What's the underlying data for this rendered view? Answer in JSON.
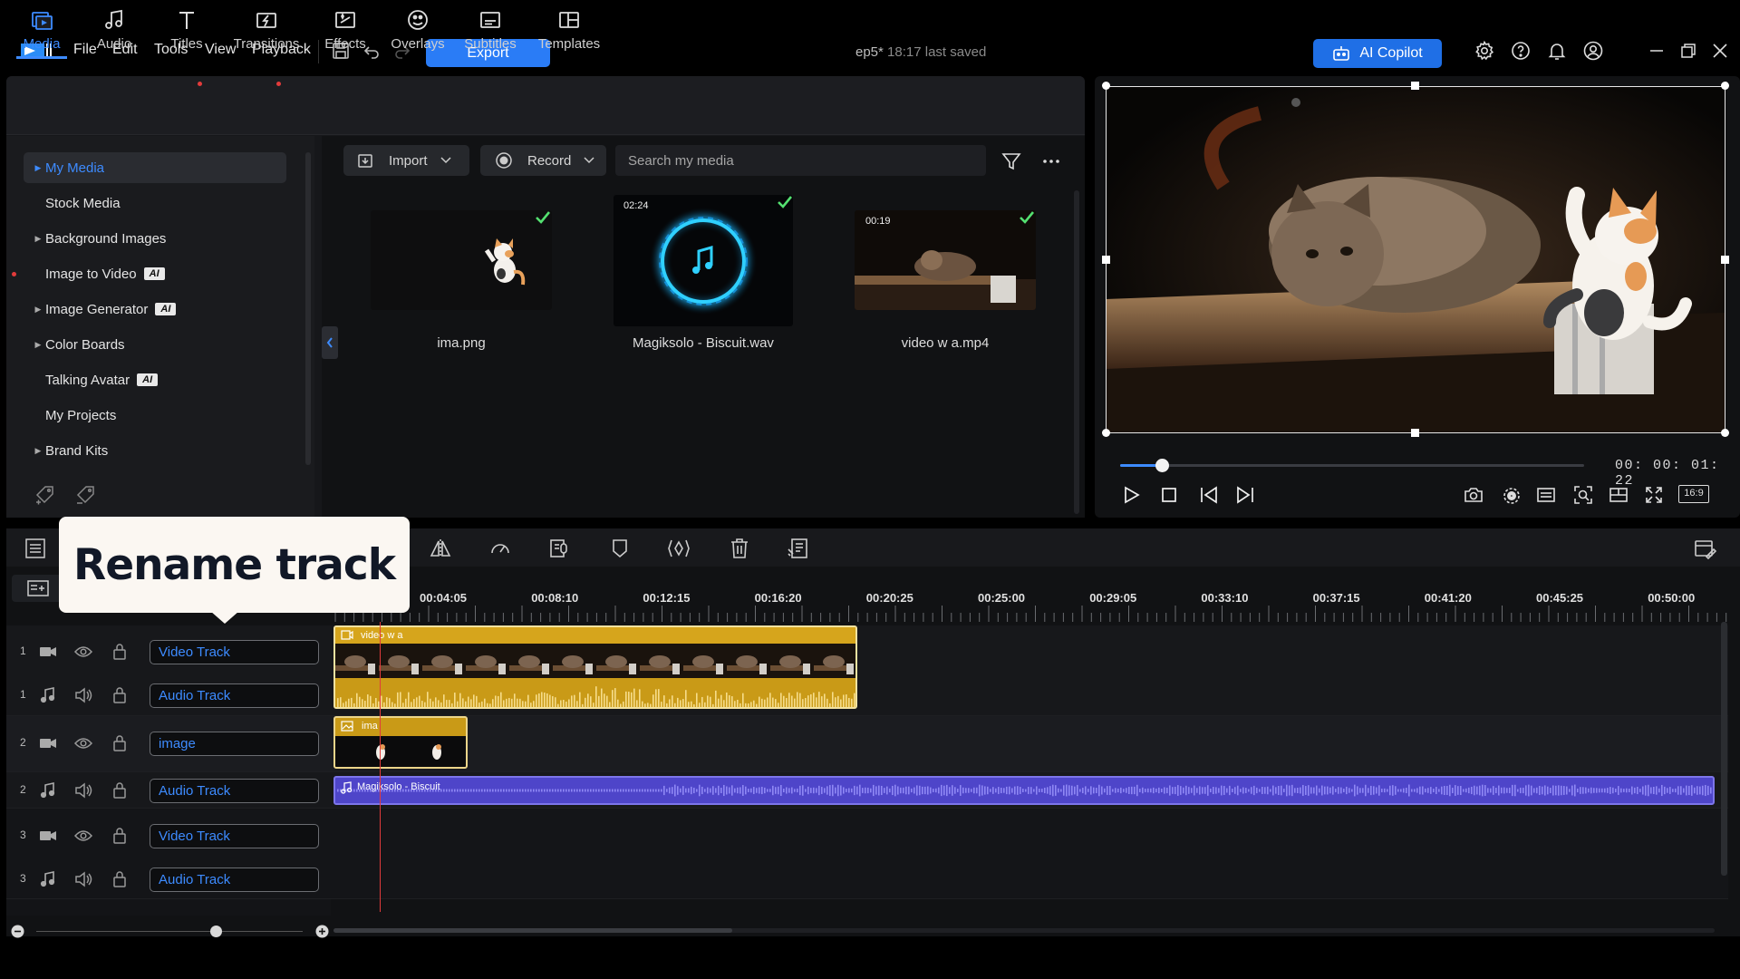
{
  "menu": {
    "file": "File",
    "edit": "Edit",
    "tools": "Tools",
    "view": "View",
    "playback": "Playback"
  },
  "export_label": "Export",
  "project": {
    "name": "ep5*",
    "saved": "18:17 last saved"
  },
  "copilot_label": "AI Copilot",
  "library_tabs": [
    {
      "label": "Media",
      "icon": "media-icon"
    },
    {
      "label": "Audio",
      "icon": "music-note-icon"
    },
    {
      "label": "Titles",
      "icon": "title-text-icon"
    },
    {
      "label": "Transitions",
      "icon": "transition-icon"
    },
    {
      "label": "Effects",
      "icon": "effects-icon"
    },
    {
      "label": "Overlays",
      "icon": "overlays-icon"
    },
    {
      "label": "Subtitles",
      "icon": "subtitles-icon"
    },
    {
      "label": "Templates",
      "icon": "templates-icon"
    }
  ],
  "tree": [
    {
      "label": "My Media"
    },
    {
      "label": "Stock Media"
    },
    {
      "label": "Background Images"
    },
    {
      "label": "Image to Video",
      "badge": "AI"
    },
    {
      "label": "Image Generator",
      "badge": "AI"
    },
    {
      "label": "Color Boards"
    },
    {
      "label": "Talking Avatar",
      "badge": "AI"
    },
    {
      "label": "My Projects"
    },
    {
      "label": "Brand Kits"
    }
  ],
  "media_toolbar": {
    "import_label": "Import",
    "record_label": "Record",
    "search_placeholder": "Search my media"
  },
  "media_items": [
    {
      "name": "ima.png",
      "duration": ""
    },
    {
      "name": "Magiksolo - Biscuit.wav",
      "duration": "02:24"
    },
    {
      "name": "video w a.mp4",
      "duration": "00:19"
    }
  ],
  "preview": {
    "timecode": "00: 00: 01: 22",
    "aspect": "16:9",
    "progress": 0.09
  },
  "ruler_ticks": [
    "00:04:05",
    "00:08:10",
    "00:12:15",
    "00:16:20",
    "00:20:25",
    "00:25:00",
    "00:29:05",
    "00:33:10",
    "00:37:15",
    "00:41:20",
    "00:45:25",
    "00:50:00"
  ],
  "tracks": [
    {
      "num": "1",
      "kind": "video",
      "name": "Video Track"
    },
    {
      "num": "1",
      "kind": "audio",
      "name": "Audio Track"
    },
    {
      "num": "2",
      "kind": "video",
      "name": "image"
    },
    {
      "num": "2",
      "kind": "audio",
      "name": "Audio Track"
    },
    {
      "num": "3",
      "kind": "video",
      "name": "Video Track"
    },
    {
      "num": "3",
      "kind": "audio",
      "name": "Audio Track"
    }
  ],
  "clips": {
    "video": "video w a",
    "image": "ima",
    "music": "Magiksolo - Biscuit"
  },
  "tooltip": "Rename track",
  "colors": {
    "accent": "#3d8bff",
    "clip_video": "#d7a21a",
    "clip_music": "#5b4fd8"
  }
}
